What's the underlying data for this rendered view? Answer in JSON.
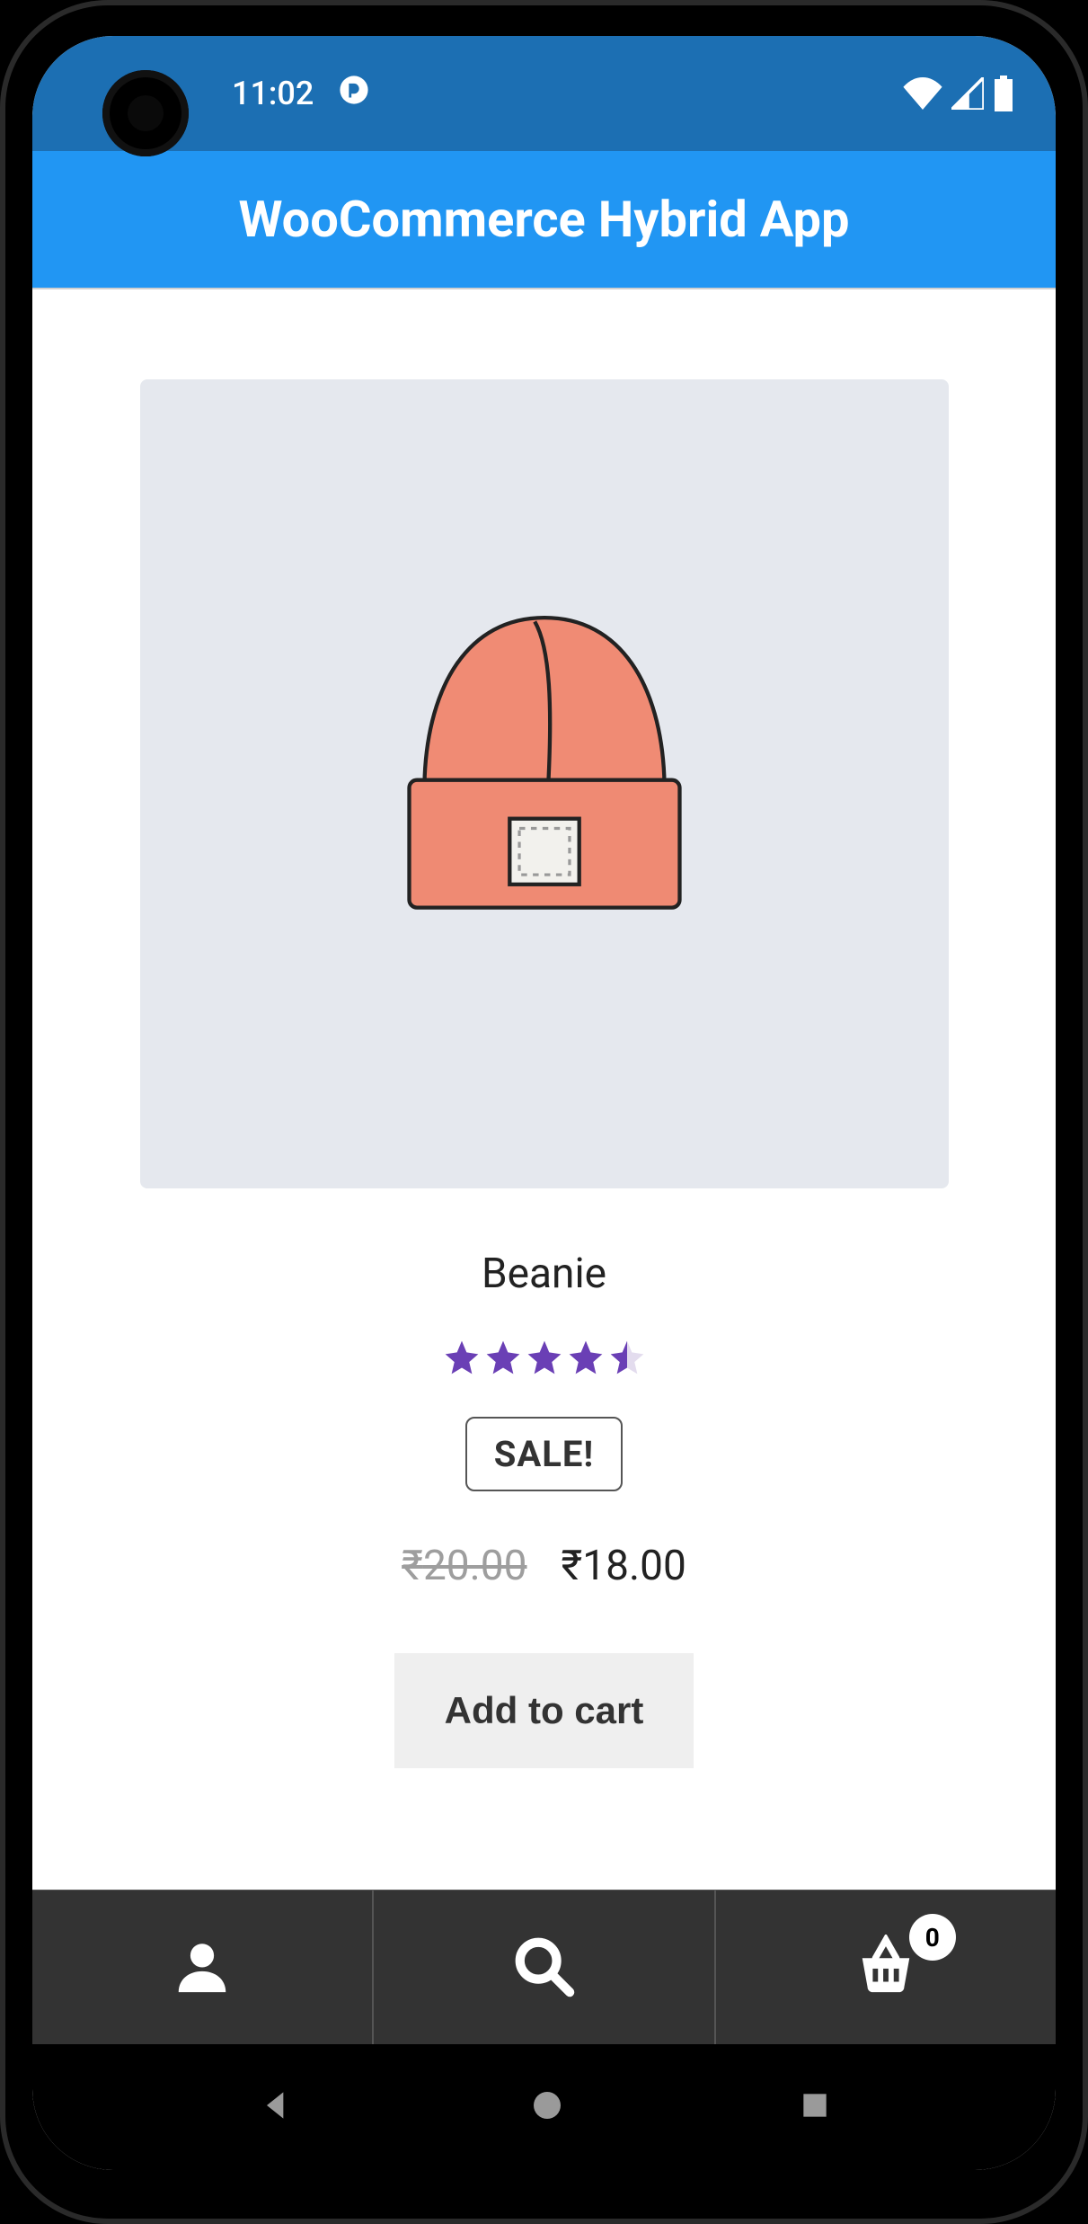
{
  "status_bar": {
    "time": "11:02",
    "icons": {
      "notification": "flag-icon",
      "wifi": true,
      "signal": true,
      "battery": true
    }
  },
  "header": {
    "title": "WooCommerce Hybrid App"
  },
  "product": {
    "name": "Beanie",
    "rating": 4.5,
    "sale_label": "SALE!",
    "currency": "₹",
    "price_original": "20.00",
    "price_sale": "18.00",
    "add_to_cart_label": "Add to cart",
    "image_alt": "orange-beanie-illustration"
  },
  "bottom_nav": {
    "items": [
      {
        "name": "account",
        "icon": "user-icon"
      },
      {
        "name": "search",
        "icon": "search-icon"
      },
      {
        "name": "cart",
        "icon": "basket-icon",
        "badge": "0"
      }
    ]
  },
  "android_nav": {
    "back": "back-button",
    "home": "home-button",
    "recents": "recents-button"
  },
  "colors": {
    "status_bar_bg": "#1c6fb3",
    "header_bg": "#2196f3",
    "star": "#6a3fb5",
    "bottom_bar_bg": "#333333"
  }
}
